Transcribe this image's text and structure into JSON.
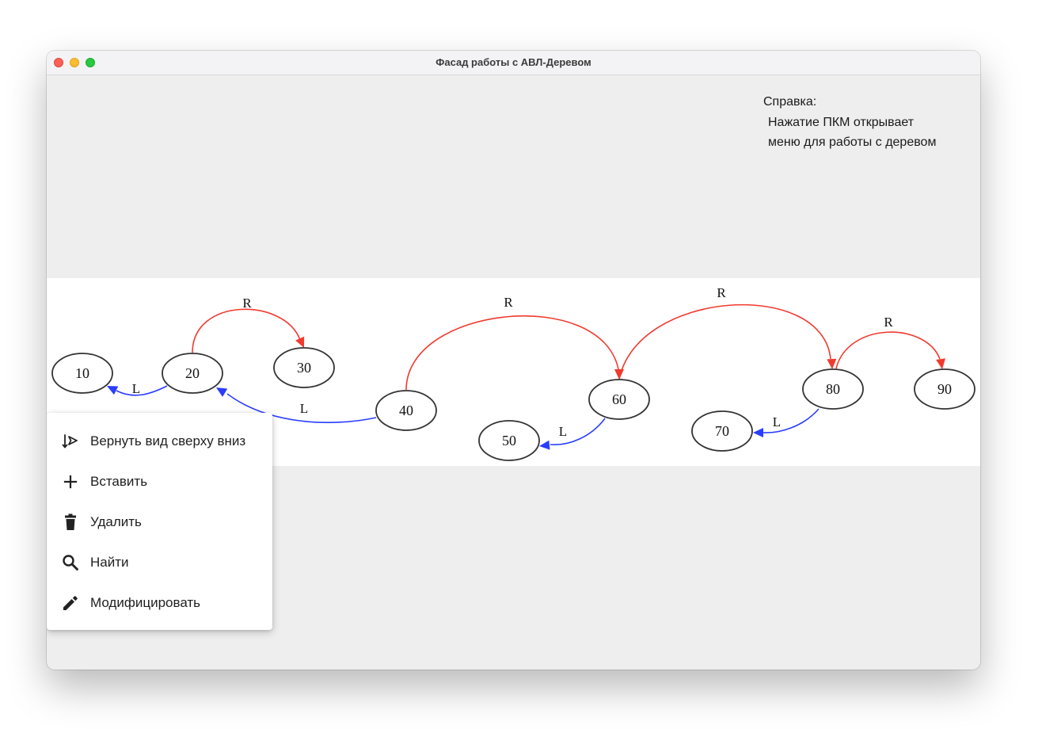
{
  "window": {
    "title": "Фасад работы с АВЛ-Деревом"
  },
  "help": {
    "heading": "Справка:",
    "line1": "Нажатие ПКМ открывает",
    "line2": "меню для работы с деревом"
  },
  "tree": {
    "nodes": [
      "10",
      "20",
      "30",
      "40",
      "50",
      "60",
      "70",
      "80",
      "90"
    ],
    "edges": [
      {
        "from": "20",
        "to": "10",
        "label": "L",
        "color": "#2a3dff"
      },
      {
        "from": "20",
        "to": "30",
        "label": "R",
        "color": "#f03a2e"
      },
      {
        "from": "40",
        "to": "20",
        "label": "L",
        "color": "#2a3dff"
      },
      {
        "from": "40",
        "to": "60",
        "label": "R",
        "color": "#f03a2e"
      },
      {
        "from": "60",
        "to": "50",
        "label": "L",
        "color": "#2a3dff"
      },
      {
        "from": "60",
        "to": "80",
        "label": "R",
        "color": "#f03a2e"
      },
      {
        "from": "80",
        "to": "70",
        "label": "L",
        "color": "#2a3dff"
      },
      {
        "from": "80",
        "to": "90",
        "label": "R",
        "color": "#f03a2e"
      }
    ]
  },
  "context_menu": {
    "items": [
      {
        "label": "Вернуть вид сверху вниз",
        "icon": "top-down-view-icon"
      },
      {
        "label": "Вставить",
        "icon": "plus-icon"
      },
      {
        "label": "Удалить",
        "icon": "trash-icon"
      },
      {
        "label": "Найти",
        "icon": "search-icon"
      },
      {
        "label": "Модифицировать",
        "icon": "pencil-icon"
      }
    ]
  },
  "colors": {
    "left_edge": "#2a3dff",
    "right_edge": "#f03a2e",
    "canvas_bg": "#eeeeee"
  }
}
